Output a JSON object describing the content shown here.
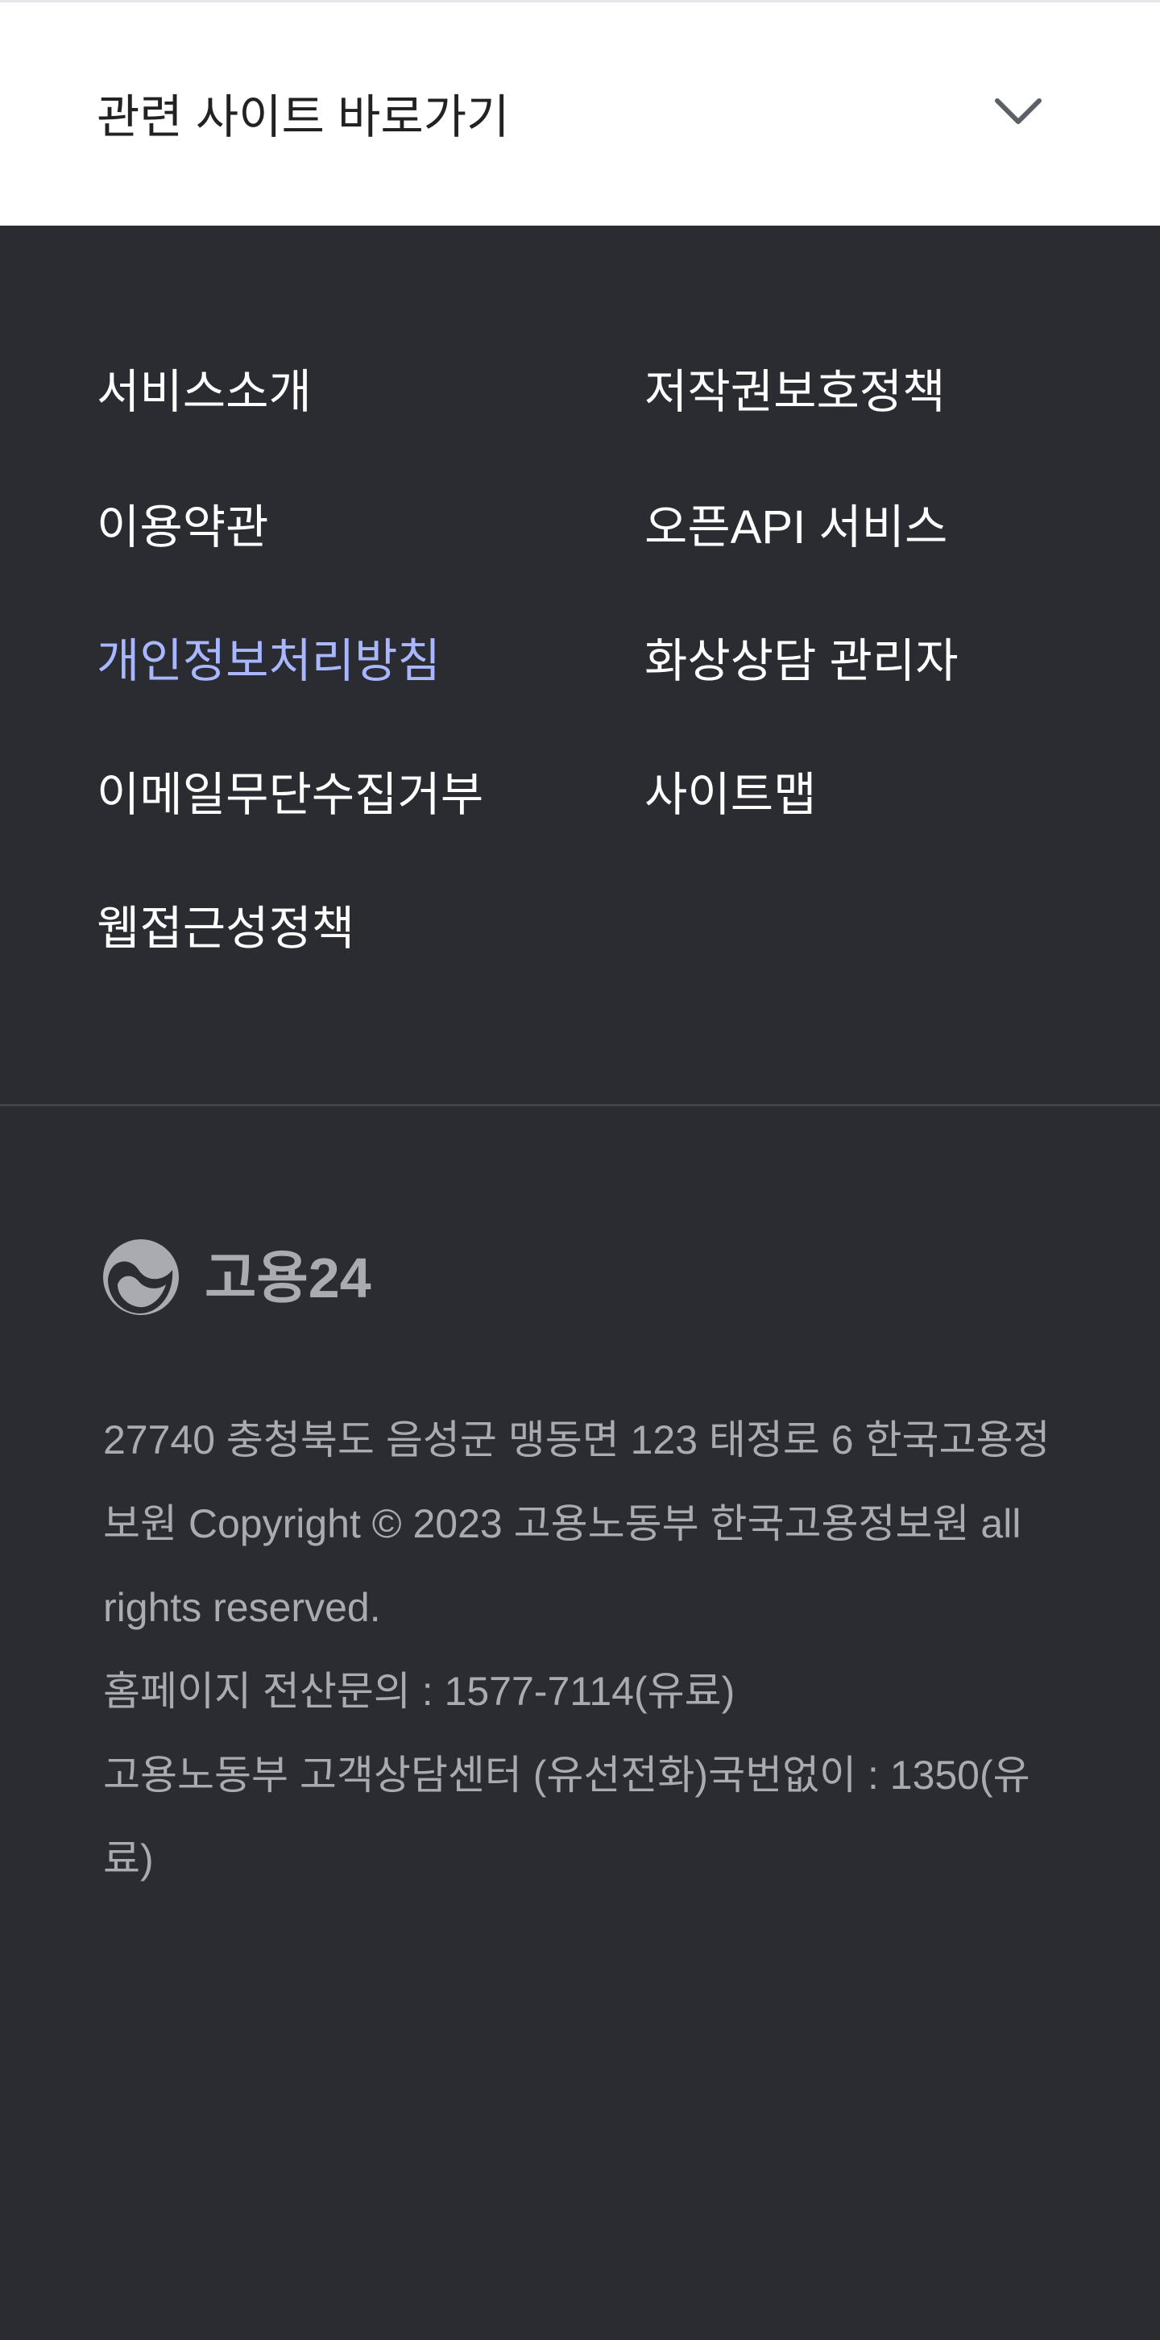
{
  "related_sites": {
    "label": "관련 사이트 바로가기",
    "toggle_icon": "chevron-down-icon"
  },
  "footer_links": {
    "left": [
      "서비스소개",
      "이용약관",
      "개인정보처리방침",
      "이메일무단수집거부",
      "웹접근성정책"
    ],
    "right": [
      "저작권보호정책",
      "오픈API 서비스",
      "화상상담 관리자",
      "사이트맵"
    ]
  },
  "colors": {
    "footer_background": "#2a2c31",
    "link_text": "#ffffff",
    "highlight_link": "#a8b7ff",
    "muted_text": "#a9abb1",
    "divider": "#40434a"
  },
  "logo": {
    "text": "고용24",
    "icon": "government-emblem-icon"
  },
  "info": {
    "address_copyright": "27740 충청북도 음성군 맹동면 123 태정로 6 한국고용정보원 Copyright © 2023 고용노동부 한국고용정보원 all rights reserved.",
    "homepage_contact": "홈페이지 전산문의 : 1577-7114(유료)",
    "center_contact": "고용노동부 고객상담센터 (유선전화)국번없이 : 1350(유료)"
  }
}
